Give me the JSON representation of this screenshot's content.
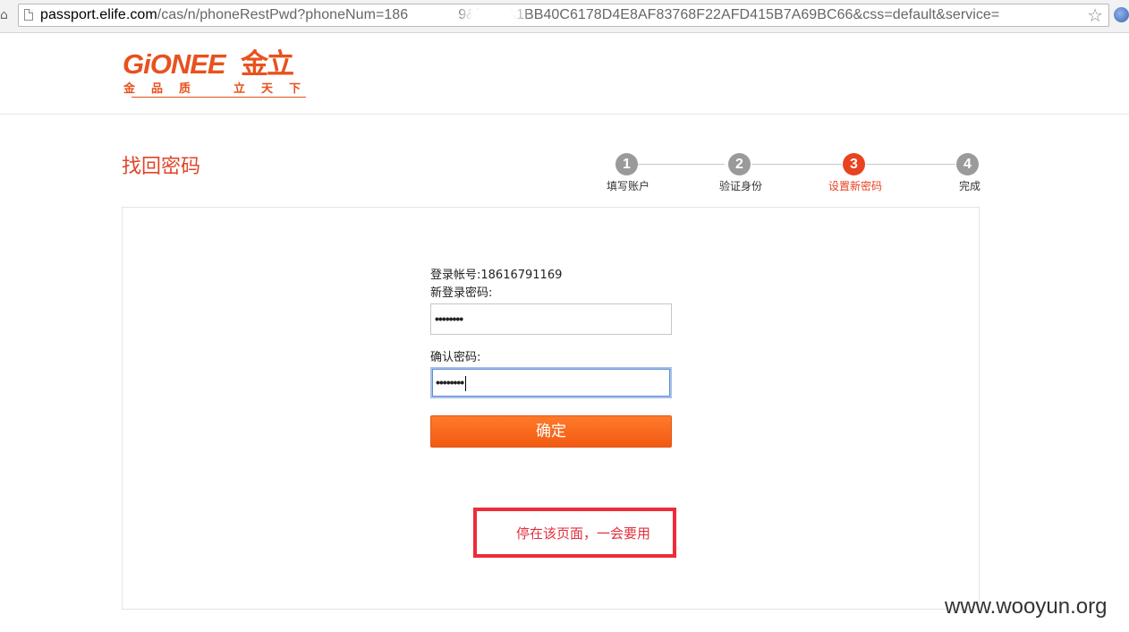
{
  "browser": {
    "url_host": "passport.elife.com",
    "url_path_before_mask": "/cas/n/phoneRestPwd?phoneNum=186",
    "url_path_after_mask": "9&key=A1BB40C6178D4E8AF83768F22AFD415B7A69BC66&css=default&service=",
    "icons": {
      "page": "page-icon",
      "bookmark": "star-icon",
      "extension": "globe-icon"
    }
  },
  "header": {
    "logo_en": "GiONEE",
    "logo_cn": "金立",
    "slogan_left": "金品质",
    "slogan_right": "立天下",
    "brand_color": "#e8511e"
  },
  "page": {
    "title": "找回密码"
  },
  "steps": [
    {
      "number": "1",
      "label": "填写账户",
      "active": false
    },
    {
      "number": "2",
      "label": "验证身份",
      "active": false
    },
    {
      "number": "3",
      "label": "设置新密码",
      "active": true
    },
    {
      "number": "4",
      "label": "完成",
      "active": false
    }
  ],
  "form": {
    "account_label": "登录帐号:18616791169",
    "new_password_label": "新登录密码:",
    "new_password_value": "••••••••",
    "confirm_password_label": "确认密码:",
    "confirm_password_value": "••••••••",
    "submit_label": "确定",
    "button_color": "#f25a12"
  },
  "annotation": {
    "text": "停在该页面，一会要用",
    "color": "#ee2b39"
  },
  "watermark": "www.wooyun.org"
}
